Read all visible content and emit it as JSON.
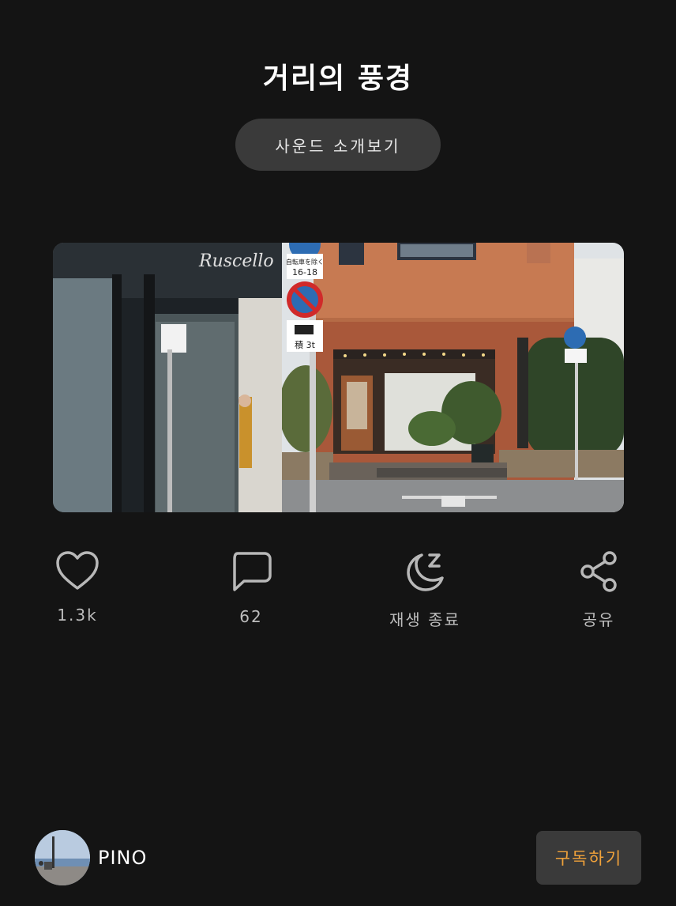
{
  "header": {
    "title": "거리의 풍경"
  },
  "intro_button": {
    "label": "사운드 소개보기"
  },
  "photo": {
    "sign_text_1": "自転車を除く",
    "sign_text_2": "16-18",
    "sign_text_3": "積 3t",
    "shop_sign": "Ruscello"
  },
  "actions": [
    {
      "label": "1.3k",
      "icon": "heart-icon"
    },
    {
      "label": "62",
      "icon": "comment-icon"
    },
    {
      "label": "재생 종료",
      "icon": "sleep-moon-icon"
    },
    {
      "label": "공유",
      "icon": "share-icon"
    }
  ],
  "footer": {
    "username": "PINO",
    "subscribe_label": "구독하기"
  },
  "colors": {
    "background": "#141414",
    "button": "#3a3a3a",
    "accent": "#f0a23a",
    "muted": "#bdbdbd"
  }
}
